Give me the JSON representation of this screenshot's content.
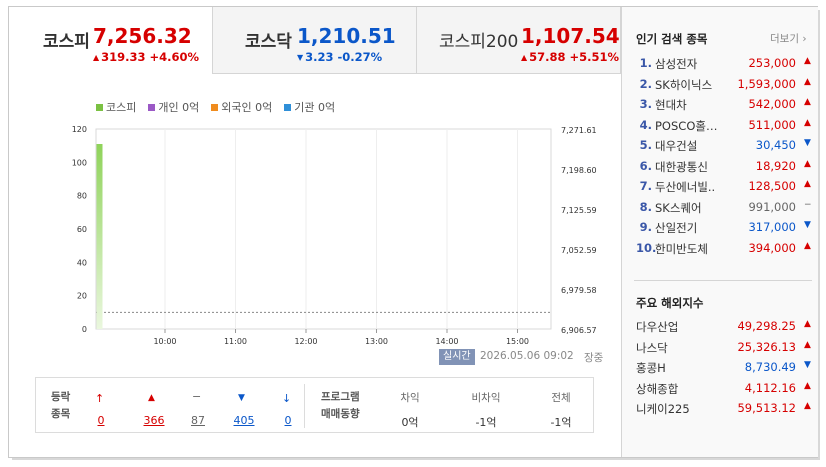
{
  "tabs": [
    {
      "name": "코스피",
      "value": "7,256.32",
      "change": "319.33 +4.60%",
      "direction": "up",
      "active": true
    },
    {
      "name": "코스닥",
      "value": "1,210.51",
      "change": "3.23 -0.27%",
      "direction": "down",
      "active": false
    },
    {
      "name": "코스피200",
      "value": "1,107.54",
      "change": "57.88 +5.51%",
      "direction": "up",
      "active": false
    }
  ],
  "legend": [
    {
      "label": "코스피",
      "color": "#7bc143"
    },
    {
      "label": "개인 0억",
      "color": "#9b59c6"
    },
    {
      "label": "외국인 0억",
      "color": "#f08c1e"
    },
    {
      "label": "기관 0억",
      "color": "#2f8fd8"
    }
  ],
  "chart_data": {
    "type": "bar",
    "y_left_ticks": [
      "120",
      "100",
      "80",
      "60",
      "40",
      "20",
      "0"
    ],
    "y_right_ticks": [
      "7,271.61",
      "7,198.60",
      "7,125.59",
      "7,052.59",
      "6,979.58",
      "6,906.57"
    ],
    "x_ticks": [
      "10:00",
      "11:00",
      "12:00",
      "13:00",
      "14:00",
      "15:00"
    ],
    "ylim": [
      0,
      120
    ],
    "series": [
      {
        "name": "코스피",
        "values": [
          111
        ],
        "color": "#7bc143"
      }
    ],
    "grid": true
  },
  "timestamp": {
    "badge": "실시간",
    "datetime": "2026.05.06 09:02",
    "session": "장중"
  },
  "stats": {
    "label_line1": "등락",
    "label_line2": "종목",
    "items": [
      {
        "icon": "↑",
        "value": "0",
        "kind": "up"
      },
      {
        "icon": "▲",
        "value": "366",
        "kind": "up"
      },
      {
        "icon": "−",
        "value": "87",
        "kind": "flat"
      },
      {
        "icon": "▼",
        "value": "405",
        "kind": "down"
      },
      {
        "icon": "↓",
        "value": "0",
        "kind": "down"
      }
    ],
    "program_label1": "프로그램",
    "program_label2": "매매동향",
    "program": [
      {
        "label": "차익",
        "value": "0억"
      },
      {
        "label": "비차익",
        "value": "-1억"
      },
      {
        "label": "전체",
        "value": "-1억"
      }
    ]
  },
  "popular": {
    "title": "인기 검색 종목",
    "more": "더보기",
    "items": [
      {
        "rank": "1.",
        "name": "삼성전자",
        "price": "253,000",
        "dir": "up"
      },
      {
        "rank": "2.",
        "name": "SK하이닉스",
        "price": "1,593,000",
        "dir": "up"
      },
      {
        "rank": "3.",
        "name": "현대차",
        "price": "542,000",
        "dir": "up"
      },
      {
        "rank": "4.",
        "name": "POSCO홀…",
        "price": "511,000",
        "dir": "up"
      },
      {
        "rank": "5.",
        "name": "대우건설",
        "price": "30,450",
        "dir": "down"
      },
      {
        "rank": "6.",
        "name": "대한광통신",
        "price": "18,920",
        "dir": "up"
      },
      {
        "rank": "7.",
        "name": "두산에너빌..",
        "price": "128,500",
        "dir": "up"
      },
      {
        "rank": "8.",
        "name": "SK스퀘어",
        "price": "991,000",
        "dir": "flat"
      },
      {
        "rank": "9.",
        "name": "산일전기",
        "price": "317,000",
        "dir": "down"
      },
      {
        "rank": "10.",
        "name": "한미반도체",
        "price": "394,000",
        "dir": "up"
      }
    ]
  },
  "world": {
    "title": "주요 해외지수",
    "items": [
      {
        "name": "다우산업",
        "value": "49,298.25",
        "dir": "up"
      },
      {
        "name": "나스닥",
        "value": "25,326.13",
        "dir": "up"
      },
      {
        "name": "홍콩H",
        "value": "8,730.49",
        "dir": "down"
      },
      {
        "name": "상해종합",
        "value": "4,112.16",
        "dir": "up"
      },
      {
        "name": "니케이225",
        "value": "59,513.12",
        "dir": "up"
      }
    ]
  },
  "marks": {
    "up": "▲",
    "down": "▼",
    "flat": "−"
  }
}
